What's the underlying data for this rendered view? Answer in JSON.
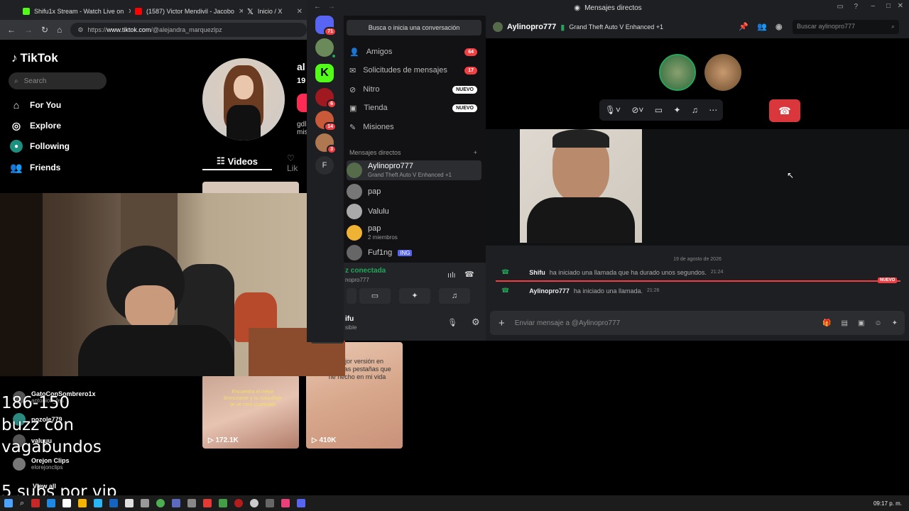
{
  "browser": {
    "tabs": [
      {
        "label": "Shifu1x Stream - Watch Live on",
        "color": "#53fc18"
      },
      {
        "label": "(1587) Victor Mendivil - Jacobo",
        "color": "#ff0000"
      },
      {
        "label": "Inicio / X",
        "color": "#ffffff"
      }
    ],
    "url_prefix": "https://",
    "url_host": "www.tiktok.com",
    "url_path": "/@alejandra_marquezlpz"
  },
  "tiktok": {
    "logo": "TikTok",
    "search_placeholder": "Search",
    "nav": [
      {
        "label": "For You",
        "icon": "home-icon"
      },
      {
        "label": "Explore",
        "icon": "compass-icon"
      },
      {
        "label": "Following",
        "icon": "following-icon"
      },
      {
        "label": "Friends",
        "icon": "friends-icon"
      }
    ],
    "profile_name_partial": "al",
    "profile_count_partial": "19",
    "bio_partial1": "gdl",
    "bio_partial2": "mis",
    "tab_videos": "Videos",
    "tab_liked": "Lik",
    "following_accounts": [
      {
        "name": "GatoConSombrero1x",
        "sub": "antonioff_fes"
      },
      {
        "name": "pozole779",
        "sub": ""
      },
      {
        "name": "valuuu",
        "sub": ""
      },
      {
        "name": "Orejon Clips",
        "sub": "elorejonclips"
      }
    ],
    "view_all": "View all",
    "thumbs": [
      {
        "views": "172.1K",
        "caption": "Encuentra el mejor bronceante y tu maquillaje se ve cero cuarteado"
      },
      {
        "views": "410K",
        "caption": "a mejor versión en máscaras pestañas que he hecho en mi vida"
      }
    ]
  },
  "discord": {
    "window_title": "Mensajes directos",
    "search_label": "Busca o inicia una conversación",
    "side_items": [
      {
        "label": "Amigos",
        "badge": "64"
      },
      {
        "label": "Solicitudes de mensajes",
        "badge": "17"
      },
      {
        "label": "Nitro",
        "badge": "NUEVO"
      },
      {
        "label": "Tienda",
        "badge": "NUEVO"
      },
      {
        "label": "Misiones",
        "badge": ""
      }
    ],
    "dm_header": "Mensajes directos",
    "dms": [
      {
        "name": "Aylinopro777",
        "sub": "Grand Theft Auto V Enhanced +1"
      },
      {
        "name": "pap",
        "sub": ""
      },
      {
        "name": "Valulu",
        "sub": ""
      },
      {
        "name": "pap",
        "sub": "2 miembros"
      },
      {
        "name": "Fuf1ng",
        "sub": "ING"
      }
    ],
    "voice_status": "z conectada",
    "voice_sub": "nopro777",
    "user_name": "ifu",
    "user_status": "sible",
    "server_badges": [
      "71",
      "6",
      "14",
      "3"
    ],
    "server_letter": "F",
    "header_user": "Aylinopro777",
    "header_game": "Grand Theft Auto V Enhanced +1",
    "header_search": "Buscar aylinopro777",
    "date_divider": "19 de agosto de 2026",
    "messages": [
      {
        "user": "Shifu",
        "text": "ha iniciado una llamada que ha durado unos segundos.",
        "time": "21:24"
      },
      {
        "user": "Aylinopro777",
        "text": "ha iniciado una llamada.",
        "time": "21:26"
      }
    ],
    "new_label": "NUEVO",
    "composer_placeholder": "Enviar mensaje a @Aylinopro777"
  },
  "overlay": {
    "line1": "186-150",
    "line2": "buzz con",
    "line3": "vagabundos",
    "line4": "5 subs por vip"
  },
  "taskbar": {
    "clock": "09:17 p. m."
  }
}
